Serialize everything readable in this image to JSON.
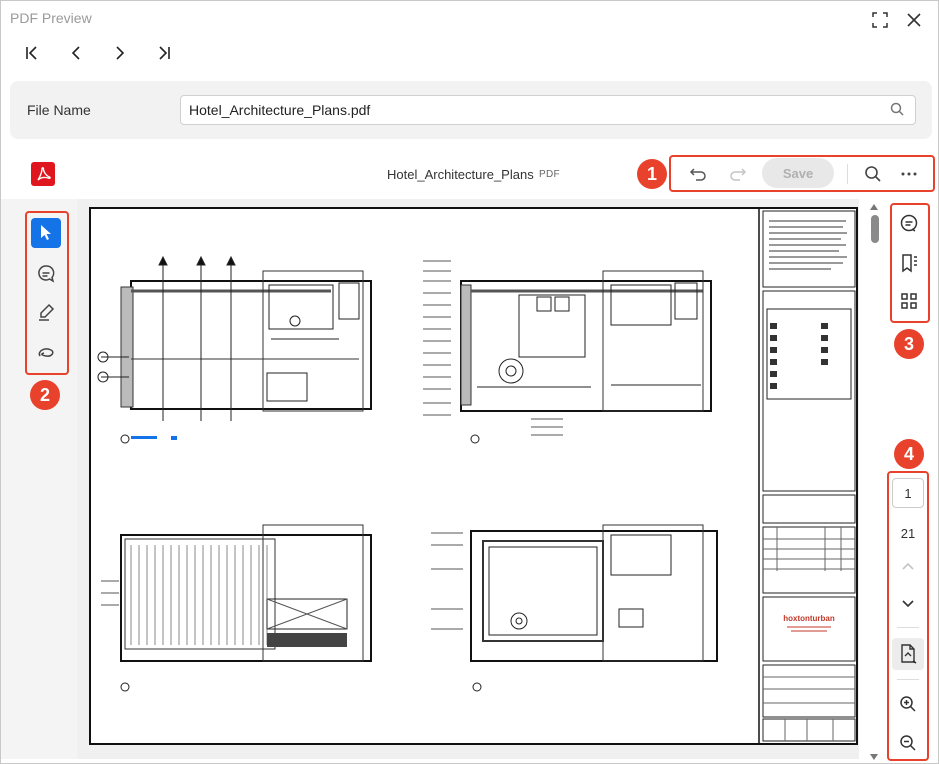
{
  "window": {
    "title": "PDF Preview"
  },
  "icons": {
    "maximize": "fullscreen-icon",
    "close": "close-icon",
    "first": "first-page-icon",
    "prev": "previous-page-icon",
    "next": "next-page-icon",
    "last": "last-page-icon"
  },
  "file": {
    "label": "File Name",
    "value": "Hotel_Architecture_Plans.pdf"
  },
  "viewer": {
    "doc_title": "Hotel_Architecture_Plans",
    "doc_type": "PDF",
    "save_label": "Save"
  },
  "callouts": {
    "one": "1",
    "two": "2",
    "three": "3",
    "four": "4"
  },
  "pagination": {
    "current_page": "1",
    "total_pages": "21"
  },
  "colors": {
    "accent": "#1473e6",
    "callout": "#e8412c",
    "pdf_brand": "#e0161e"
  }
}
